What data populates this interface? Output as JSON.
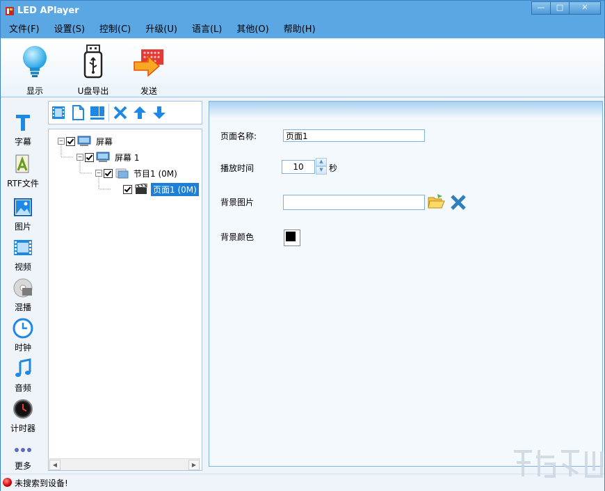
{
  "window": {
    "title": "LED APlayer",
    "buttons": {
      "minimize": "—",
      "maximize": "□",
      "close": "✕"
    }
  },
  "menu": [
    {
      "label": "文件(F)"
    },
    {
      "label": "设置(S)"
    },
    {
      "label": "控制(C)"
    },
    {
      "label": "升级(U)"
    },
    {
      "label": "语言(L)"
    },
    {
      "label": "其他(O)"
    },
    {
      "label": "帮助(H)"
    }
  ],
  "toolbar": {
    "display": {
      "label": "显示",
      "icon": "lightbulb-icon"
    },
    "usb_export": {
      "label": "U盘导出",
      "icon": "usb-drive-icon"
    },
    "send": {
      "label": "发送",
      "icon": "send-icon"
    }
  },
  "left_sidebar": [
    {
      "label": "字幕",
      "icon": "text-icon"
    },
    {
      "label": "RTF文件",
      "icon": "rtf-file-icon"
    },
    {
      "label": "图片",
      "icon": "image-icon"
    },
    {
      "label": "视频",
      "icon": "video-icon"
    },
    {
      "label": "混播",
      "icon": "mixed-play-icon"
    },
    {
      "label": "时钟",
      "icon": "clock-icon"
    },
    {
      "label": "音频",
      "icon": "music-icon"
    },
    {
      "label": "计时器",
      "icon": "timer-icon"
    },
    {
      "label": "更多",
      "icon": "more-icon"
    }
  ],
  "tree_toolbar": {
    "buttons": [
      "add-program-icon",
      "add-page-icon",
      "add-area-icon",
      "delete-icon",
      "move-up-icon",
      "move-down-icon"
    ]
  },
  "tree": {
    "root": {
      "label": "屏幕"
    },
    "screen": {
      "label": "屏幕 1"
    },
    "program": {
      "label": "节目1 (0M)"
    },
    "page": {
      "label": "页面1 (0M)"
    }
  },
  "form": {
    "page_name": {
      "label": "页面名称:",
      "value": "页面1"
    },
    "play_time": {
      "label": "播放时间",
      "value": "10",
      "unit": "秒"
    },
    "bg_image": {
      "label": "背景图片",
      "value": ""
    },
    "bg_color": {
      "label": "背景颜色",
      "value": "#000000"
    }
  },
  "status": {
    "text": "未搜索到设备!"
  },
  "colors": {
    "titlebar": "#5aa7e3",
    "selection": "#1e7fd8",
    "status_dot": "#d10000"
  }
}
